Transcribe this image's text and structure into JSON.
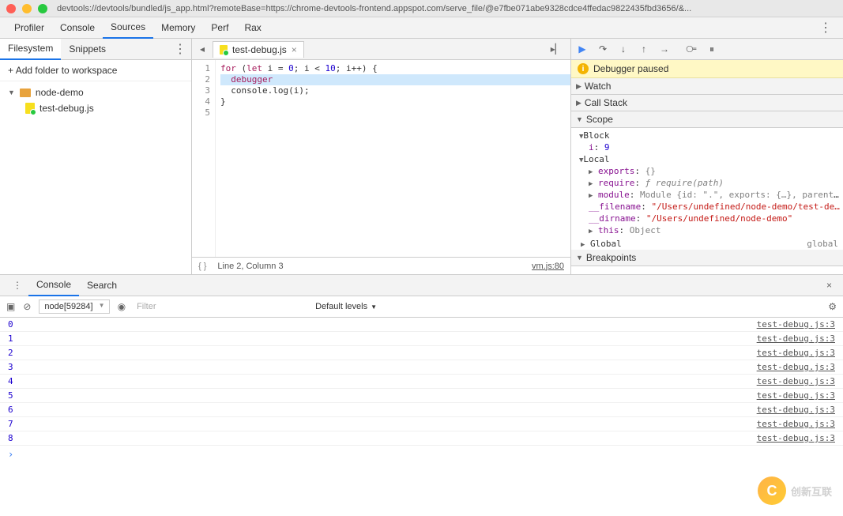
{
  "titlebar": {
    "url": "devtools://devtools/bundled/js_app.html?remoteBase=https://chrome-devtools-frontend.appspot.com/serve_file/@e7fbe071abe9328cdce4ffedac9822435fbd3656/&..."
  },
  "toolbar": {
    "tabs": [
      "Profiler",
      "Console",
      "Sources",
      "Memory",
      "Perf",
      "Rax"
    ],
    "active": "Sources"
  },
  "sidebar": {
    "tabs": [
      "Filesystem",
      "Snippets"
    ],
    "active": "Filesystem",
    "addFolder": "Add folder to workspace",
    "tree": {
      "folder": "node-demo",
      "file": "test-debug.js"
    }
  },
  "editor": {
    "tab": "test-debug.js",
    "lines": [
      {
        "n": 1,
        "tokens": [
          [
            "kw",
            "for"
          ],
          [
            "op",
            " ("
          ],
          [
            "kw",
            "let"
          ],
          [
            "op",
            " "
          ],
          [
            "ident",
            "i"
          ],
          [
            "op",
            " = "
          ],
          [
            "num",
            "0"
          ],
          [
            "op",
            "; "
          ],
          [
            "ident",
            "i"
          ],
          [
            "op",
            " < "
          ],
          [
            "num",
            "10"
          ],
          [
            "op",
            "; "
          ],
          [
            "ident",
            "i"
          ],
          [
            "op",
            "++) {"
          ]
        ]
      },
      {
        "n": 2,
        "hl": true,
        "tokens": [
          [
            "op",
            "  "
          ],
          [
            "kw",
            "debugger"
          ]
        ]
      },
      {
        "n": 3,
        "tokens": [
          [
            "op",
            "  console.log("
          ],
          [
            "ident",
            "i"
          ],
          [
            "op",
            ");"
          ]
        ]
      },
      {
        "n": 4,
        "tokens": [
          [
            "op",
            "}"
          ]
        ]
      },
      {
        "n": 5,
        "tokens": []
      }
    ],
    "status": {
      "pos": "Line 2, Column 3",
      "src": "vm.js:80"
    }
  },
  "debug": {
    "paused": "Debugger paused",
    "sections": {
      "watch": "Watch",
      "callstack": "Call Stack",
      "scope": "Scope",
      "breakpoints": "Breakpoints"
    },
    "scope": {
      "block": {
        "label": "Block",
        "vars": [
          {
            "name": "i",
            "val": "9",
            "type": "num"
          }
        ]
      },
      "local": {
        "label": "Local",
        "vars": [
          {
            "name": "exports",
            "val": "{}",
            "type": "obj",
            "exp": true
          },
          {
            "name": "require",
            "val": "ƒ require(path)",
            "type": "fn",
            "exp": true
          },
          {
            "name": "module",
            "val": "Module {id: \".\", exports: {…}, parent: …",
            "type": "obj",
            "exp": true
          },
          {
            "name": "__filename",
            "val": "\"/Users/undefined/node-demo/test-de…",
            "type": "str"
          },
          {
            "name": "__dirname",
            "val": "\"/Users/undefined/node-demo\"",
            "type": "str"
          },
          {
            "name": "this",
            "val": "Object",
            "type": "obj",
            "exp": true
          }
        ]
      },
      "global": {
        "label": "Global",
        "val": "global"
      }
    }
  },
  "console": {
    "tabs": [
      "Console",
      "Search"
    ],
    "active": "Console",
    "context": "node[59284]",
    "filterPlaceholder": "Filter",
    "levels": "Default levels",
    "logs": [
      {
        "val": "0",
        "src": "test-debug.js:3"
      },
      {
        "val": "1",
        "src": "test-debug.js:3"
      },
      {
        "val": "2",
        "src": "test-debug.js:3"
      },
      {
        "val": "3",
        "src": "test-debug.js:3"
      },
      {
        "val": "4",
        "src": "test-debug.js:3"
      },
      {
        "val": "5",
        "src": "test-debug.js:3"
      },
      {
        "val": "6",
        "src": "test-debug.js:3"
      },
      {
        "val": "7",
        "src": "test-debug.js:3"
      },
      {
        "val": "8",
        "src": "test-debug.js:3"
      }
    ]
  },
  "watermark": "创新互联"
}
